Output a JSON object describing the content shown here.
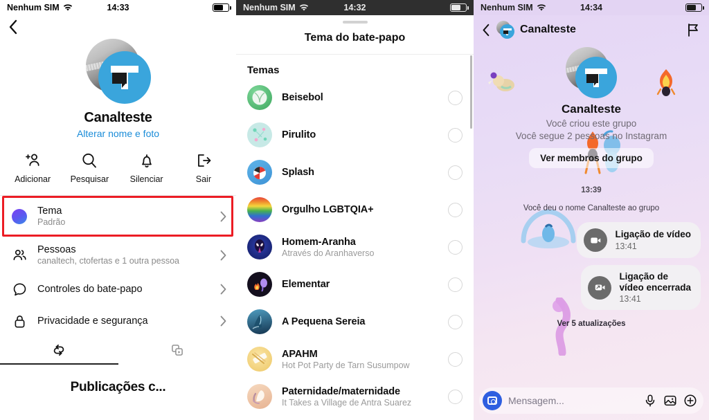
{
  "panel1": {
    "status": {
      "carrier": "Nenhum SIM",
      "time": "14:33"
    },
    "back_icon": "chevron-left-icon",
    "profile": {
      "name": "Canalteste",
      "edit_link": "Alterar nome e foto"
    },
    "actions": [
      {
        "icon": "add-person-icon",
        "label": "Adicionar"
      },
      {
        "icon": "search-icon",
        "label": "Pesquisar"
      },
      {
        "icon": "bell-icon",
        "label": "Silenciar"
      },
      {
        "icon": "exit-icon",
        "label": "Sair"
      }
    ],
    "rows": [
      {
        "icon": "theme-dot-icon",
        "title": "Tema",
        "sub": "Padrão",
        "highlighted": true
      },
      {
        "icon": "people-icon",
        "title": "Pessoas",
        "sub": "canaltech, ctofertas e 1 outra pessoa",
        "highlighted": false
      },
      {
        "icon": "chat-bubble-icon",
        "title": "Controles do bate-papo",
        "sub": "",
        "highlighted": false
      },
      {
        "icon": "lock-icon",
        "title": "Privacidade e segurança",
        "sub": "",
        "highlighted": false
      }
    ],
    "tabs": [
      {
        "icon": "shared-posts-icon",
        "active": true
      },
      {
        "icon": "media-icon",
        "active": false
      }
    ],
    "footer_title": "Publicações c..."
  },
  "panel2": {
    "status": {
      "carrier": "Nenhum SIM",
      "time": "14:32"
    },
    "sheet_title": "Tema do bate-papo",
    "section_title": "Temas",
    "themes": [
      {
        "name": "Beisebol",
        "sub": "",
        "selected": false,
        "color": "#52bf72"
      },
      {
        "name": "Pirulito",
        "sub": "",
        "selected": false,
        "color": "#bfe8e0"
      },
      {
        "name": "Splash",
        "sub": "",
        "selected": false,
        "color": "#5fb4e8"
      },
      {
        "name": "Orgulho LGBTQIA+",
        "sub": "",
        "selected": false,
        "color": "#e8453c"
      },
      {
        "name": "Homem-Aranha",
        "sub": "Através do Aranhaverso",
        "selected": false,
        "color": "#1b2a80"
      },
      {
        "name": "Elementar",
        "sub": "",
        "selected": false,
        "color": "#171320"
      },
      {
        "name": "A Pequena Sereia",
        "sub": "",
        "selected": false,
        "color": "#2b6f94"
      },
      {
        "name": "APAHM",
        "sub": "Hot Pot Party de Tarn Susumpow",
        "selected": false,
        "color": "#f2d88c"
      },
      {
        "name": "Paternidade/maternidade",
        "sub": "It Takes a Village de Antra Suarez",
        "selected": false,
        "color": "#f0c9ac"
      }
    ]
  },
  "panel3": {
    "status": {
      "carrier": "Nenhum SIM",
      "time": "14:34"
    },
    "header": {
      "back_icon": "chevron-left-icon",
      "name": "Canalteste",
      "flag_icon": "flag-icon"
    },
    "group": {
      "name": "Canalteste",
      "line1": "Você criou este grupo",
      "line2": "Você segue 2 pessoas no Instagram",
      "members_button": "Ver membros do grupo"
    },
    "timeline_time": "13:39",
    "system_message": "Você deu o nome Canalteste ao grupo",
    "messages": [
      {
        "icon": "video-call-icon",
        "title": "Ligação de vídeo",
        "time": "13:41"
      },
      {
        "icon": "video-call-ended-icon",
        "title": "Ligação de\nvídeo encerrada",
        "time": "13:41"
      }
    ],
    "updates_link": "Ver 5 atualizações",
    "composer": {
      "camera_icon": "camera-icon",
      "placeholder": "Mensagem...",
      "mic_icon": "microphone-icon",
      "gallery_icon": "image-icon",
      "plus_icon": "plus-icon"
    }
  },
  "colors": {
    "accent_blue": "#1a8cd8",
    "highlight_red": "#ec1c24",
    "brand_blue": "#3aa5dc",
    "lavender": "#e5d6f5"
  }
}
